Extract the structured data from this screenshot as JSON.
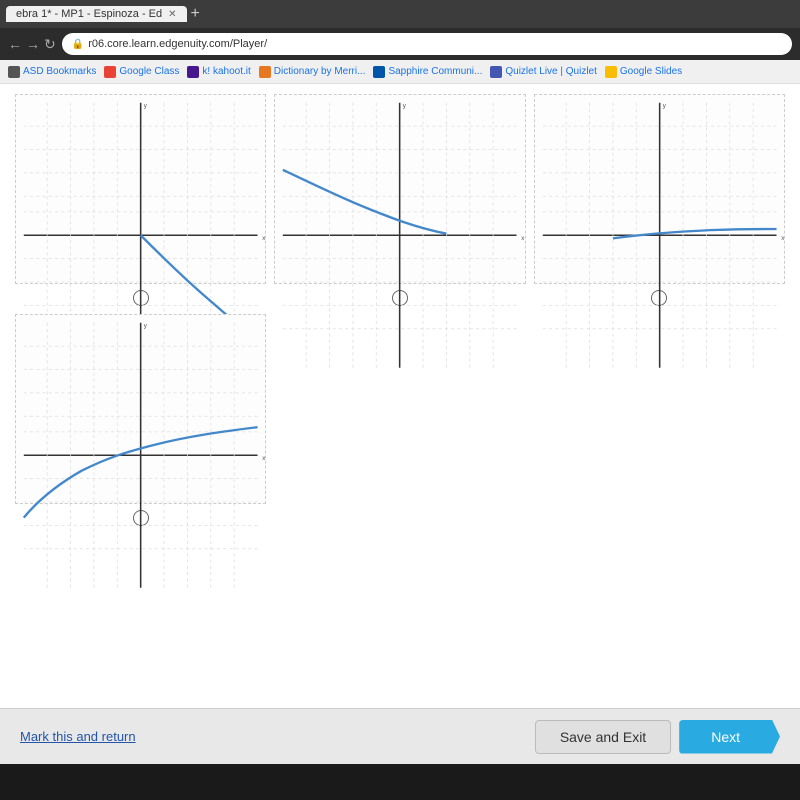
{
  "browser": {
    "tab_title": "ebra 1* - MP1 - Espinoza - Ed",
    "url": "r06.core.learn.edgenuity.com/Player/",
    "tab_plus": "+",
    "bookmarks": [
      {
        "label": "ASD Bookmarks"
      },
      {
        "label": "Google Class"
      },
      {
        "label": "kahoot.it"
      },
      {
        "label": "Dictionary by Merri..."
      },
      {
        "label": "Sapphire Communi..."
      },
      {
        "label": "Quizlet Live | Quizlet"
      },
      {
        "label": "Google Slides"
      }
    ]
  },
  "quiz": {
    "graphs": [
      {
        "id": 1,
        "description": "Square root curve going down-right from upper left, negative slope"
      },
      {
        "id": 2,
        "description": "Square root curve going down-right from y~3, decreasing"
      },
      {
        "id": 3,
        "description": "Square root curve in lower right, positive, slight curve"
      },
      {
        "id": 4,
        "description": "Square root curve going up-right from negative x, positive slope"
      }
    ],
    "radio_options": [
      "option-1",
      "option-2",
      "option-3",
      "option-4"
    ]
  },
  "footer": {
    "mark_return_label": "Mark this and return",
    "save_exit_label": "Save and Exit",
    "next_label": "Next"
  },
  "icons": {
    "lock": "🔒",
    "back": "←",
    "forward": "→",
    "refresh": "↻",
    "home": "⌂"
  }
}
